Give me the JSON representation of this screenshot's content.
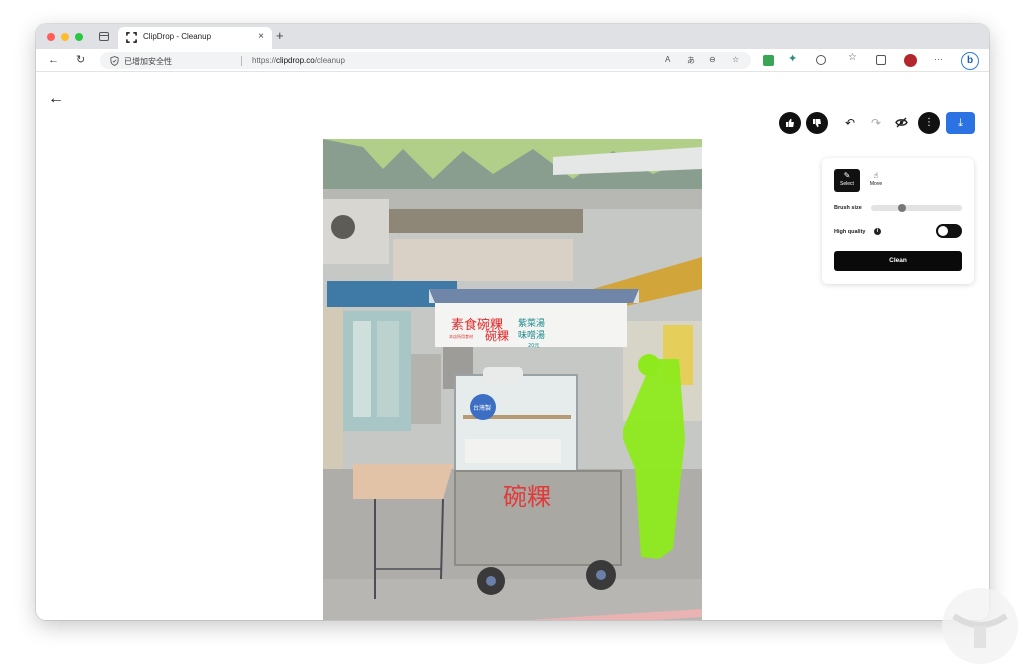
{
  "browser": {
    "tab_title": "ClipDrop - Cleanup",
    "tab_close": "×",
    "new_tab": "+",
    "back": "←",
    "reload": "↻",
    "security_label": "已增加安全性",
    "url_scheme": "https://",
    "url_host": "clipdrop.co",
    "url_path": "/cleanup",
    "read_aloud": "A",
    "translate": "あ",
    "zoom": "⊖",
    "favorite": "☆",
    "more": "···",
    "bing": "b"
  },
  "app": {
    "back": "←",
    "undo": "↶",
    "redo": "↷",
    "more": "⋮",
    "download": "⤓"
  },
  "photo": {
    "sign_main": "素食碗粿",
    "sign_main_right": "碗粿",
    "sign_soup_1": "紫菜湯",
    "sign_soup_2": "味噌湯",
    "sign_small_left": "本店所用食材",
    "sign_price": "20元",
    "sticker": "台灣製",
    "cart_name": "碗粿"
  },
  "panel": {
    "mode_select_icon": "✎",
    "mode_select": "Select",
    "mode_move_icon": "☝",
    "mode_move": "Move",
    "brush_size_label": "Brush size",
    "brush_size": 0.33,
    "high_quality_label": "High quality",
    "info": "i",
    "high_quality_on": true,
    "clean_label": "Clean"
  },
  "colors": {
    "accent": "#2b73e3",
    "mask": "#8eea1c",
    "dark": "#111111"
  }
}
